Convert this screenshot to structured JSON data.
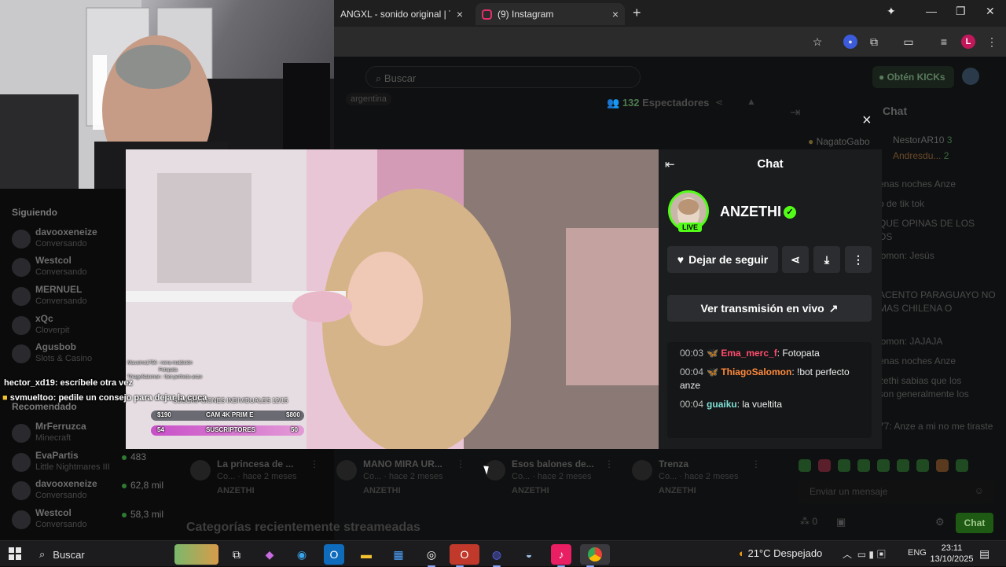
{
  "browser": {
    "tabs": [
      {
        "title": "ANGXL - sonido original | TikTo",
        "close": "×"
      },
      {
        "title": "(9) Instagram",
        "close": "×"
      }
    ],
    "new_tab": "+",
    "window_controls": [
      "—",
      "❐",
      "✕"
    ],
    "profile_initial": "L"
  },
  "kick": {
    "search_placeholder": "Buscar",
    "kicks_button": "Obtén KICKs",
    "tag": "argentina",
    "viewers_count": "132",
    "viewers_label": "Espectadores",
    "chat_title": "Chat",
    "close": "×",
    "right_chat": {
      "names": [
        "NagatoGabo",
        "NestorAR10",
        "Andresdu..."
      ],
      "counts": [
        "3",
        "2"
      ],
      "lines": [
        "enas noches Anze",
        "o de tik tok",
        "QUE OPINAS DE LOS",
        "OS",
        "lomon: Jesús",
        "ACENTO PARAGUAYO NO",
        "MAS CHILENA O",
        "lomon: JAJAJA",
        "enas noches Anze",
        "zethi sabias que los",
        "son generalmente los",
        "77: Anze a mi no me tiraste"
      ]
    },
    "send_placeholder": "Enviar un mensaje",
    "points": "0",
    "send_button": "Chat"
  },
  "sidebar": {
    "following_label": "Siguiendo",
    "following": [
      {
        "name": "davooxeneize",
        "sub": "Conversando"
      },
      {
        "name": "Westcol",
        "sub": "Conversando"
      },
      {
        "name": "MERNUEL",
        "sub": "Conversando"
      },
      {
        "name": "xQc",
        "sub": "Cloverpit"
      },
      {
        "name": "Agusbob",
        "sub": "Slots & Casino"
      }
    ],
    "recommended_label": "Recomendado",
    "recommended": [
      {
        "name": "MrFerruzca",
        "sub": "Minecraft",
        "count": ""
      },
      {
        "name": "EvaPartis",
        "sub": "Little Nightmares III",
        "count": "483"
      },
      {
        "name": "davooxeneize",
        "sub": "Conversando",
        "count": "62,8 mil"
      },
      {
        "name": "Westcol",
        "sub": "Conversando",
        "count": "58,3 mil"
      }
    ]
  },
  "overlay_chat": [
    {
      "user": "hector_xd19",
      "text": ": escríbele otra vez"
    },
    {
      "user": "svmueltoo",
      "text": ": pedile un consejo para dejar la cuca"
    }
  ],
  "video_overlay": {
    "title": "SUSCRIPCIONES INDIVIDUALES 12/15",
    "bar1": {
      "left": "$190",
      "center": "CAM 4K PRIM E",
      "right": "$800"
    },
    "bar2": {
      "left": "54",
      "center": "SUSCRIPTORES",
      "right": "50"
    },
    "mini_chat": [
      "Massimo1756 : nena maldición",
      "Fotopata",
      "ThiagoSalomon : !bot perfecto anze"
    ]
  },
  "panel": {
    "title": "Chat",
    "channel_name": "ANZETHI",
    "live": "LIVE",
    "follow_button": "Dejar de seguir",
    "watch_button": "Ver transmisión en vivo",
    "messages": [
      {
        "time": "00:03",
        "user": "Ema_merc_f",
        "color": "#ff4d6d",
        "text": ": Fotopata"
      },
      {
        "time": "00:04",
        "user": "ThiagoSalomon",
        "color": "#ff8a3d",
        "text": ": !bot perfecto anze"
      },
      {
        "time": "00:04",
        "user": "guaiku",
        "color": "#7fe0d6",
        "text": ": la vueltita"
      }
    ]
  },
  "clips": [
    {
      "title": "La princesa de ...",
      "meta": "Co... · hace 2 meses",
      "channel": "ANZETHI"
    },
    {
      "title": "MANO MIRA UR...",
      "meta": "Co... · hace 2 meses",
      "channel": "ANZETHI"
    },
    {
      "title": "Esos balones de...",
      "meta": "Co... · hace 2 meses",
      "channel": "ANZETHI"
    },
    {
      "title": "Trenza",
      "meta": "Co... · hace 2 meses",
      "channel": "ANZETHI"
    }
  ],
  "categories_title": "Categorías recientemente streameadas",
  "taskbar": {
    "search": "Buscar",
    "weather": "21°C Despejado",
    "lang": "ENG",
    "time": "23:11",
    "date": "13/10/2025"
  },
  "colors": {
    "kick_green": "#53fc18",
    "panel_bg": "#1b1c1e"
  }
}
